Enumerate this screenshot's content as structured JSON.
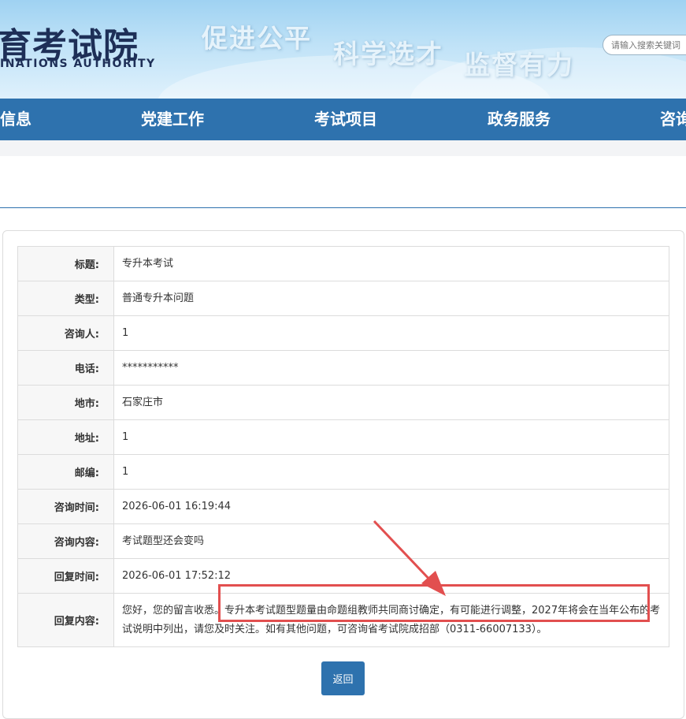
{
  "header": {
    "logo_cn": "育考试院",
    "logo_en": "INATIONS AUTHORITY",
    "slogans": [
      "促进公平",
      "科学选才",
      "监督有力"
    ],
    "search_placeholder": "请输入搜索关键词"
  },
  "nav": {
    "items": [
      "信息",
      "党建工作",
      "考试项目",
      "政务服务",
      "咨询"
    ]
  },
  "detail": {
    "rows": [
      {
        "label": "标题:",
        "value": "专升本考试"
      },
      {
        "label": "类型:",
        "value": "普通专升本问题"
      },
      {
        "label": "咨询人:",
        "value": "1"
      },
      {
        "label": "电话:",
        "value": "***********"
      },
      {
        "label": "地市:",
        "value": "石家庄市"
      },
      {
        "label": "地址:",
        "value": "1"
      },
      {
        "label": "邮编:",
        "value": "1"
      },
      {
        "label": "咨询时间:",
        "value": "2026-06-01 16:19:44"
      },
      {
        "label": "咨询内容:",
        "value": "考试题型还会变吗"
      },
      {
        "label": "回复时间:",
        "value": "2026-06-01 17:52:12"
      }
    ],
    "reply": {
      "label": "回复内容:",
      "value": "您好，您的留言收悉。专升本考试题型题量由命题组教师共同商讨确定，有可能进行调整，2027年将会在当年公布的考试说明中列出，请您及时关注。如有其他问题，可咨询省考试院成招部（0311-66007133）。"
    }
  },
  "actions": {
    "back_label": "返回"
  },
  "colors": {
    "nav_bg": "#2e72ae",
    "annotation": "#e24f4f"
  }
}
